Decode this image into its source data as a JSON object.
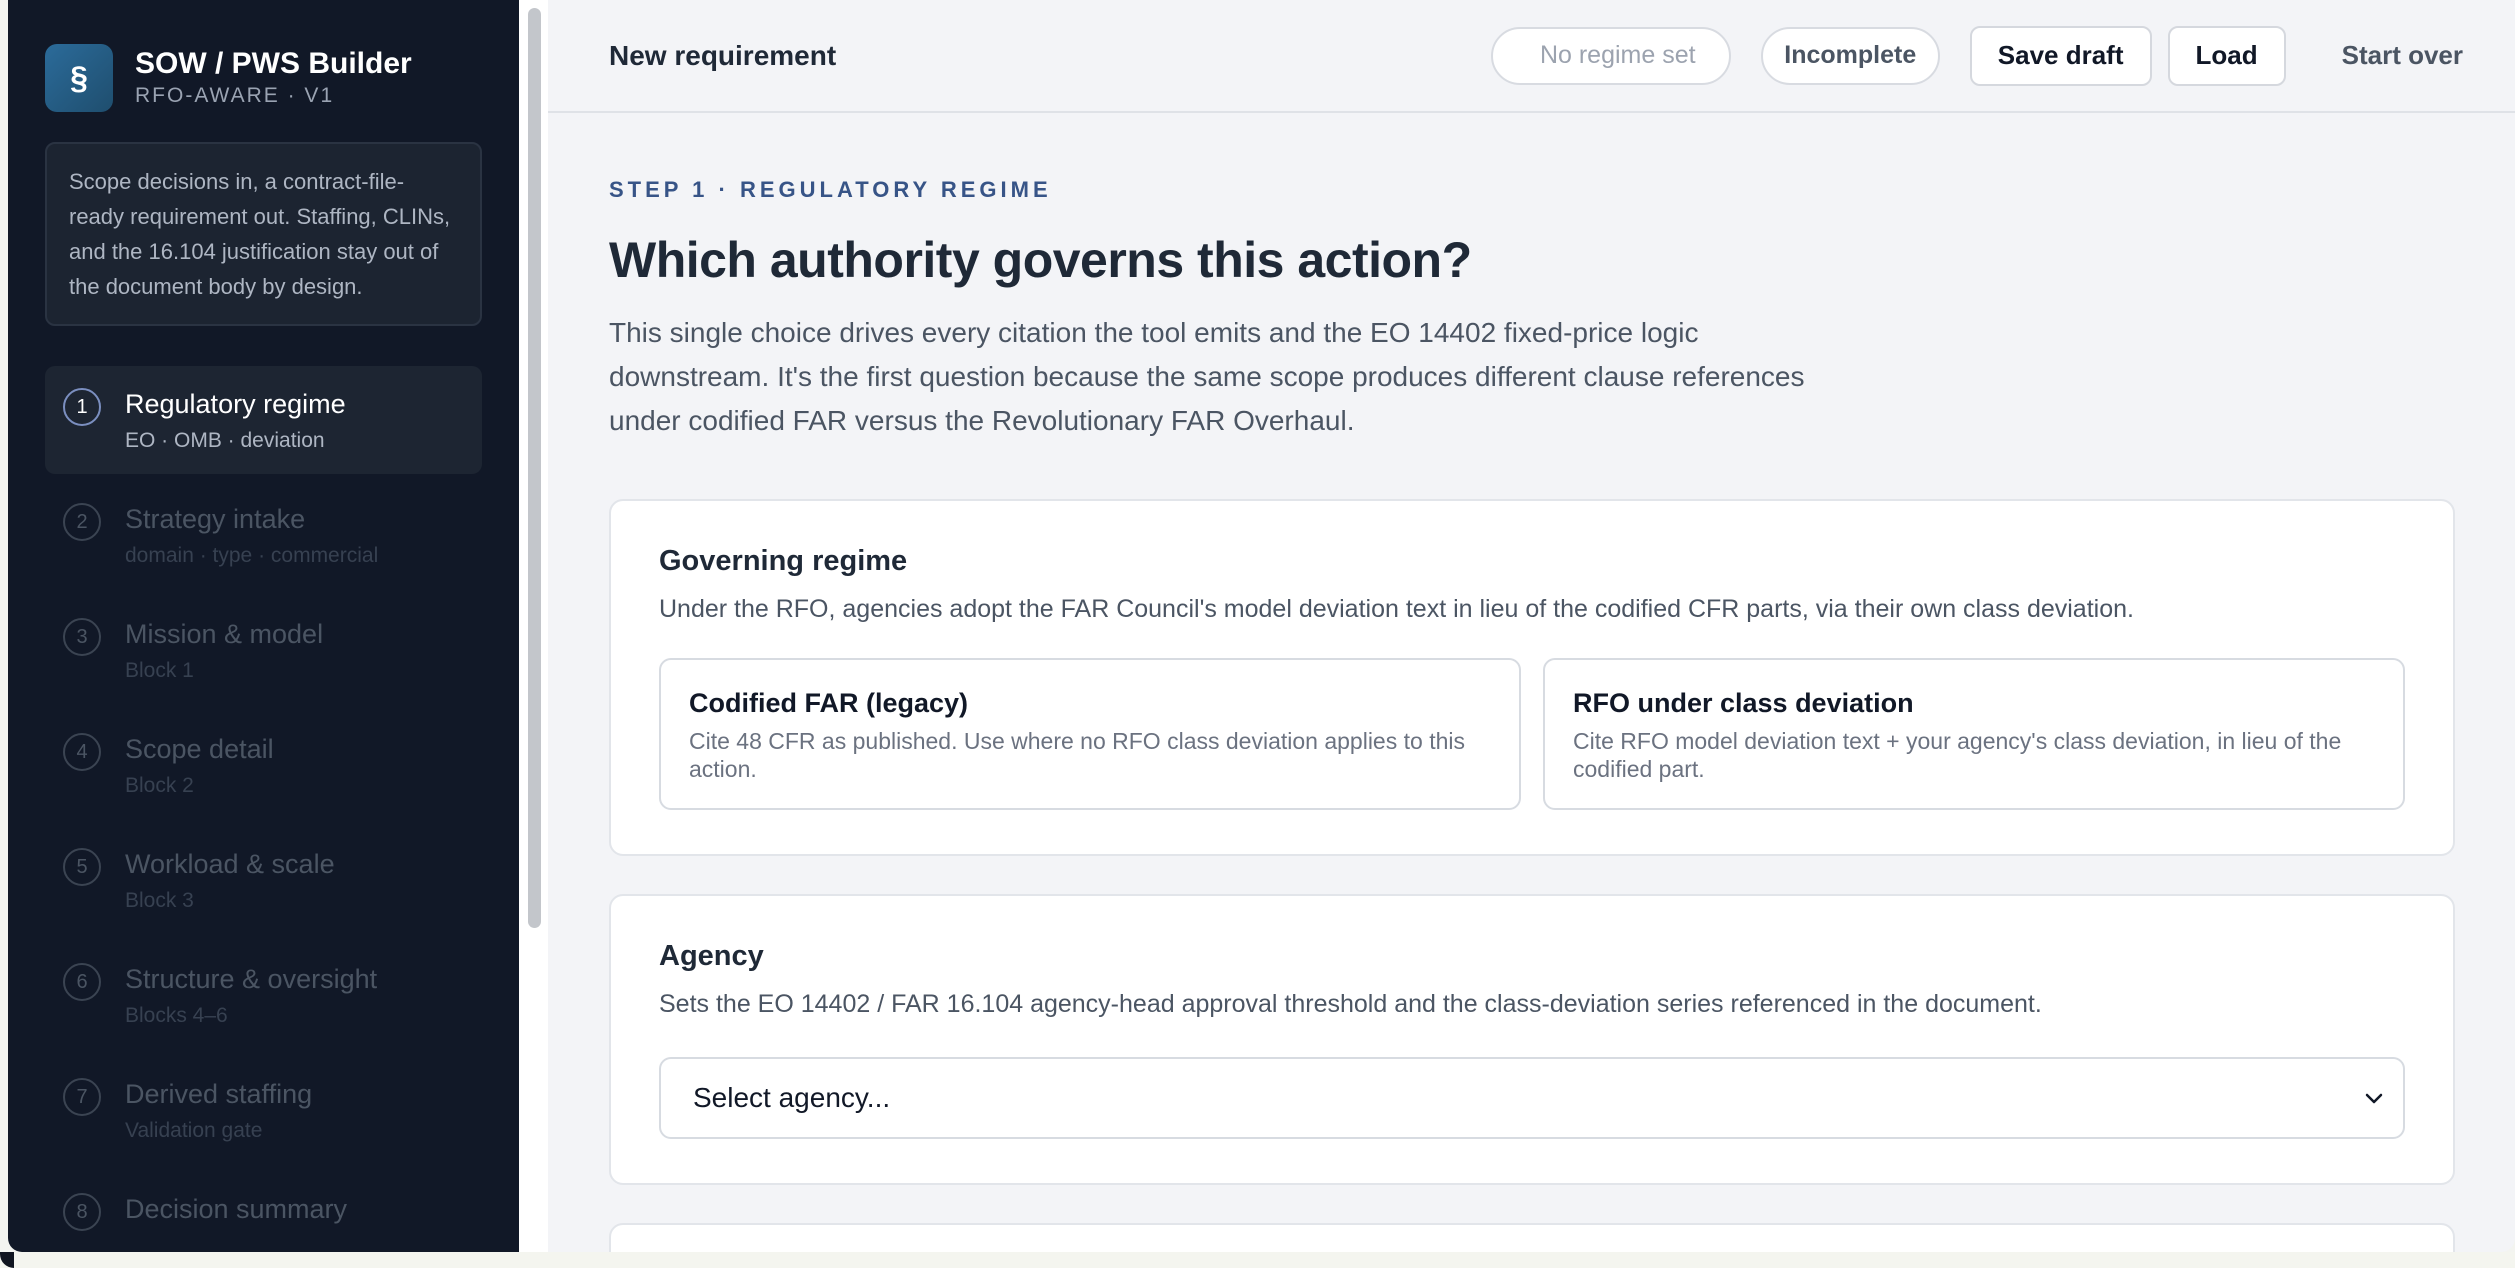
{
  "brand": {
    "logo_glyph": "§",
    "title": "SOW / PWS Builder",
    "subtitle": "RFO-AWARE · V1"
  },
  "intro_text": "Scope decisions in, a contract-file-ready requirement out. Staffing, CLINs, and the 16.104 justification stay out of the document body by design.",
  "steps": [
    {
      "num": "1",
      "label": "Regulatory regime",
      "sub": "EO · OMB · deviation",
      "active": true
    },
    {
      "num": "2",
      "label": "Strategy intake",
      "sub": "domain · type · commercial",
      "active": false
    },
    {
      "num": "3",
      "label": "Mission & model",
      "sub": "Block 1",
      "active": false
    },
    {
      "num": "4",
      "label": "Scope detail",
      "sub": "Block 2",
      "active": false
    },
    {
      "num": "5",
      "label": "Workload & scale",
      "sub": "Block 3",
      "active": false
    },
    {
      "num": "6",
      "label": "Structure & oversight",
      "sub": "Blocks 4–6",
      "active": false
    },
    {
      "num": "7",
      "label": "Derived staffing",
      "sub": "Validation gate",
      "active": false
    },
    {
      "num": "8",
      "label": "Decision summary",
      "sub": "",
      "active": false
    }
  ],
  "topbar": {
    "title": "New requirement",
    "regime_chip": "No regime set",
    "status_chip": "Incomplete",
    "save_label": "Save draft",
    "load_label": "Load",
    "start_over_label": "Start over"
  },
  "page": {
    "eyebrow": "STEP 1 · REGULATORY REGIME",
    "title": "Which authority governs this action?",
    "lead": "This single choice drives every citation the tool emits and the EO 14402 fixed-price logic downstream. It's the first question because the same scope produces different clause references under codified FAR versus the Revolutionary FAR Overhaul."
  },
  "governing_regime": {
    "title": "Governing regime",
    "description": "Under the RFO, agencies adopt the FAR Council's model deviation text in lieu of the codified CFR parts, via their own class deviation.",
    "options": [
      {
        "title": "Codified FAR (legacy)",
        "description": "Cite 48 CFR as published. Use where no RFO class deviation applies to this action."
      },
      {
        "title": "RFO under class deviation",
        "description": "Cite RFO model deviation text + your agency's class deviation, in lieu of the codified part."
      }
    ]
  },
  "agency": {
    "title": "Agency",
    "description": "Sets the EO 14402 / FAR 16.104 agency-head approval threshold and the class-deviation series referenced in the document.",
    "select_value": "Select agency..."
  },
  "icons": {
    "select_chevron": "chevron-down-icon"
  }
}
